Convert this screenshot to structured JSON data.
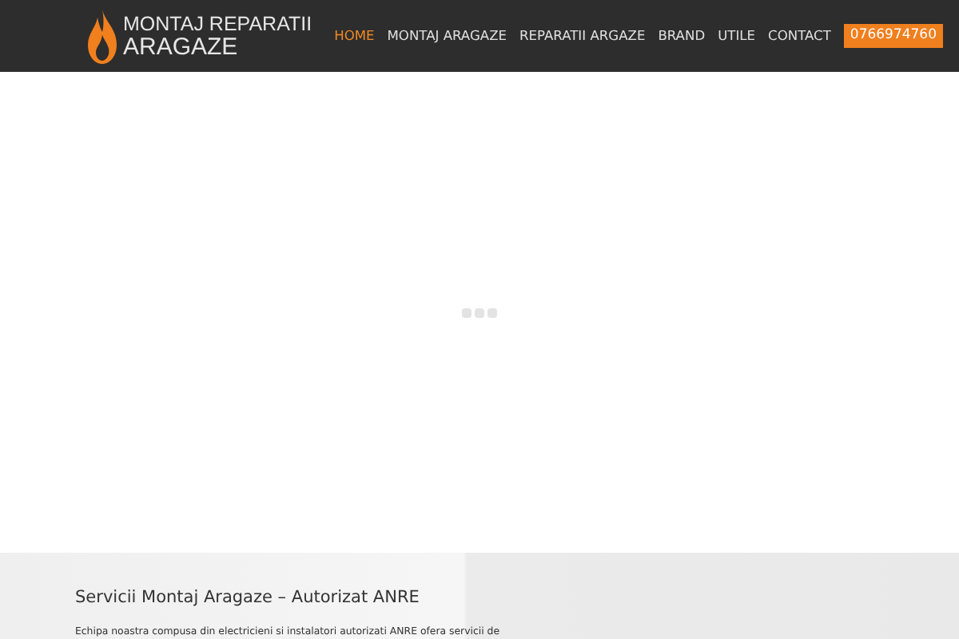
{
  "logo": {
    "line_1": "MONTAJ REPARATII",
    "line_2": "ARAGAZE"
  },
  "menu": [
    {
      "label": "HOME",
      "selected": true
    },
    {
      "label": "MONTAJ ARAGAZE",
      "selected": false
    },
    {
      "label": "REPARATII ARGAZE",
      "selected": false
    },
    {
      "label": "BRAND",
      "selected": false
    },
    {
      "label": "UTILE",
      "selected": false
    },
    {
      "label": "CONTACT",
      "selected": false
    }
  ],
  "phone": "0766974760",
  "intro": {
    "title": "Servicii Montaj Aragaze – Autorizat ANRE",
    "text": "Echipa noastra compusa din electricieni si instalatori autorizati ANRE ofera servicii de"
  }
}
